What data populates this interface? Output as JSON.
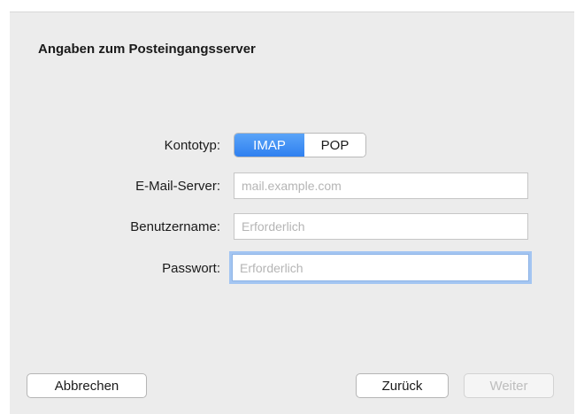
{
  "dialog": {
    "title": "Angaben zum Posteingangsserver"
  },
  "account_type": {
    "label": "Kontotyp:",
    "options": [
      "IMAP",
      "POP"
    ],
    "selected": "IMAP"
  },
  "mail_server": {
    "label": "E-Mail-Server:",
    "value": "",
    "placeholder": "mail.example.com"
  },
  "username": {
    "label": "Benutzername:",
    "value": "",
    "placeholder": "Erforderlich"
  },
  "password": {
    "label": "Passwort:",
    "value": "",
    "placeholder": "Erforderlich"
  },
  "buttons": {
    "cancel": "Abbrechen",
    "back": "Zurück",
    "next": "Weiter"
  },
  "colors": {
    "accent": "#2f80f0",
    "focus_ring": "#a3c5f2",
    "background": "#ececec"
  }
}
